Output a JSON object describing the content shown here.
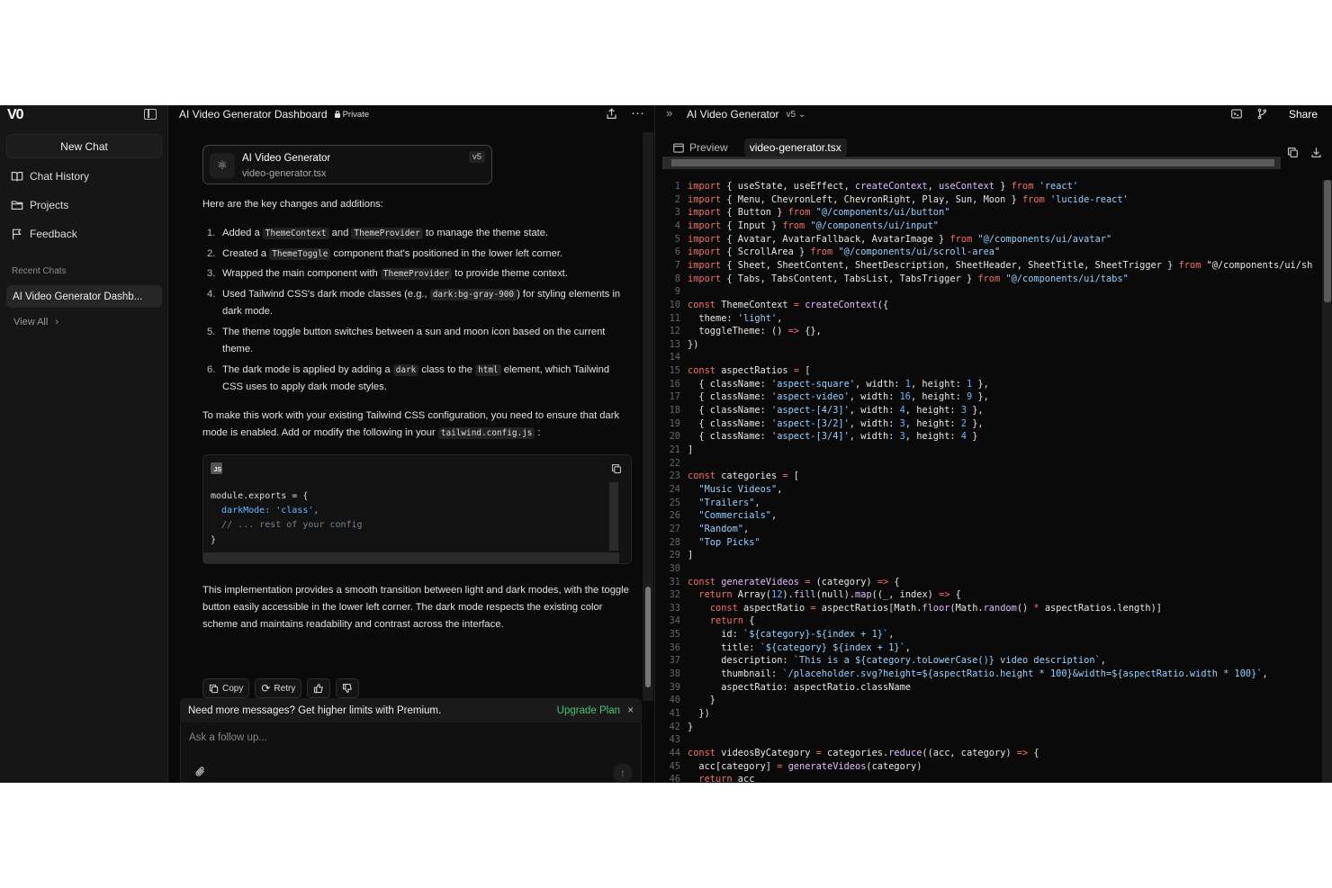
{
  "sidebar": {
    "logo": "V0",
    "new_chat": "New Chat",
    "items": [
      {
        "label": "Chat History",
        "icon": "book-icon"
      },
      {
        "label": "Projects",
        "icon": "folder-icon"
      },
      {
        "label": "Feedback",
        "icon": "flag-icon"
      }
    ],
    "recent_label": "Recent Chats",
    "recent_chats": [
      "AI Video Generator Dashb..."
    ],
    "view_all": "View All"
  },
  "chat": {
    "title": "AI Video Generator Dashboard",
    "visibility": "Private",
    "version_card": {
      "title": "AI Video Generator",
      "file": "video-generator.tsx",
      "version": "v5"
    },
    "intro": "Here are the key changes and additions:",
    "list": [
      {
        "n": "1.",
        "parts": [
          "Added a ",
          "@ThemeContext",
          " and ",
          "@ThemeProvider",
          " to manage the theme state."
        ]
      },
      {
        "n": "2.",
        "parts": [
          "Created a ",
          "@ThemeToggle",
          " component that's positioned in the lower left corner."
        ]
      },
      {
        "n": "3.",
        "parts": [
          "Wrapped the main component with ",
          "@ThemeProvider",
          " to provide theme context."
        ]
      },
      {
        "n": "4.",
        "parts": [
          "Used Tailwind CSS's dark mode classes (e.g., ",
          "@dark:bg-gray-900",
          ") for styling elements in dark mode."
        ]
      },
      {
        "n": "5.",
        "parts": [
          "The theme toggle button switches between a sun and moon icon based on the current theme."
        ]
      },
      {
        "n": "6.",
        "parts": [
          "The dark mode is applied by adding a ",
          "@dark",
          " class to the ",
          "@html",
          " element, which Tailwind CSS uses to apply dark mode styles."
        ]
      }
    ],
    "config_para": [
      "To make this work with your existing Tailwind CSS configuration, you need to ensure that dark mode is enabled. Add or modify the following in your ",
      "@tailwind.config.js",
      " :"
    ],
    "code_lang": "JS",
    "code_lines": [
      "module.exports = {",
      "  darkMode: 'class',",
      "  // ... rest of your config",
      "}"
    ],
    "summary": "This implementation provides a smooth transition between light and dark modes, with the toggle button easily accessible in the lower left corner. The dark mode respects the existing color scheme and maintains readability and contrast across the interface.",
    "actions": {
      "copy": "Copy",
      "retry": "Retry"
    },
    "upgrade_text": "Need more messages? Get higher limits with Premium.",
    "upgrade_link": "Upgrade Plan",
    "input_placeholder": "Ask a follow up..."
  },
  "panel": {
    "title": "AI Video Generator",
    "version": "v5",
    "share": "Share",
    "tabs": [
      "Preview",
      "video-generator.tsx"
    ],
    "code": [
      "import { useState, useEffect, createContext, useContext } from 'react'",
      "import { Menu, ChevronLeft, ChevronRight, Play, Sun, Moon } from 'lucide-react'",
      "import { Button } from \"@/components/ui/button\"",
      "import { Input } from \"@/components/ui/input\"",
      "import { Avatar, AvatarFallback, AvatarImage } from \"@/components/ui/avatar\"",
      "import { ScrollArea } from \"@/components/ui/scroll-area\"",
      "import { Sheet, SheetContent, SheetDescription, SheetHeader, SheetTitle, SheetTrigger } from \"@/components/ui/sh",
      "import { Tabs, TabsContent, TabsList, TabsTrigger } from \"@/components/ui/tabs\"",
      "",
      "const ThemeContext = createContext({",
      "  theme: 'light',",
      "  toggleTheme: () => {},",
      "})",
      "",
      "const aspectRatios = [",
      "  { className: 'aspect-square', width: 1, height: 1 },",
      "  { className: 'aspect-video', width: 16, height: 9 },",
      "  { className: 'aspect-[4/3]', width: 4, height: 3 },",
      "  { className: 'aspect-[3/2]', width: 3, height: 2 },",
      "  { className: 'aspect-[3/4]', width: 3, height: 4 }",
      "]",
      "",
      "const categories = [",
      "  \"Music Videos\",",
      "  \"Trailers\",",
      "  \"Commercials\",",
      "  \"Random\",",
      "  \"Top Picks\"",
      "]",
      "",
      "const generateVideos = (category) => {",
      "  return Array(12).fill(null).map((_, index) => {",
      "    const aspectRatio = aspectRatios[Math.floor(Math.random() * aspectRatios.length)]",
      "    return {",
      "      id: `${category}-${index + 1}`,",
      "      title: `${category} ${index + 1}`,",
      "      description: `This is a ${category.toLowerCase()} video description`,",
      "      thumbnail: `/placeholder.svg?height=${aspectRatio.height * 100}&width=${aspectRatio.width * 100}`,",
      "      aspectRatio: aspectRatio.className",
      "    }",
      "  })",
      "}",
      "",
      "const videosByCategory = categories.reduce((acc, category) => {",
      "  acc[category] = generateVideos(category)",
      "  return acc"
    ]
  }
}
